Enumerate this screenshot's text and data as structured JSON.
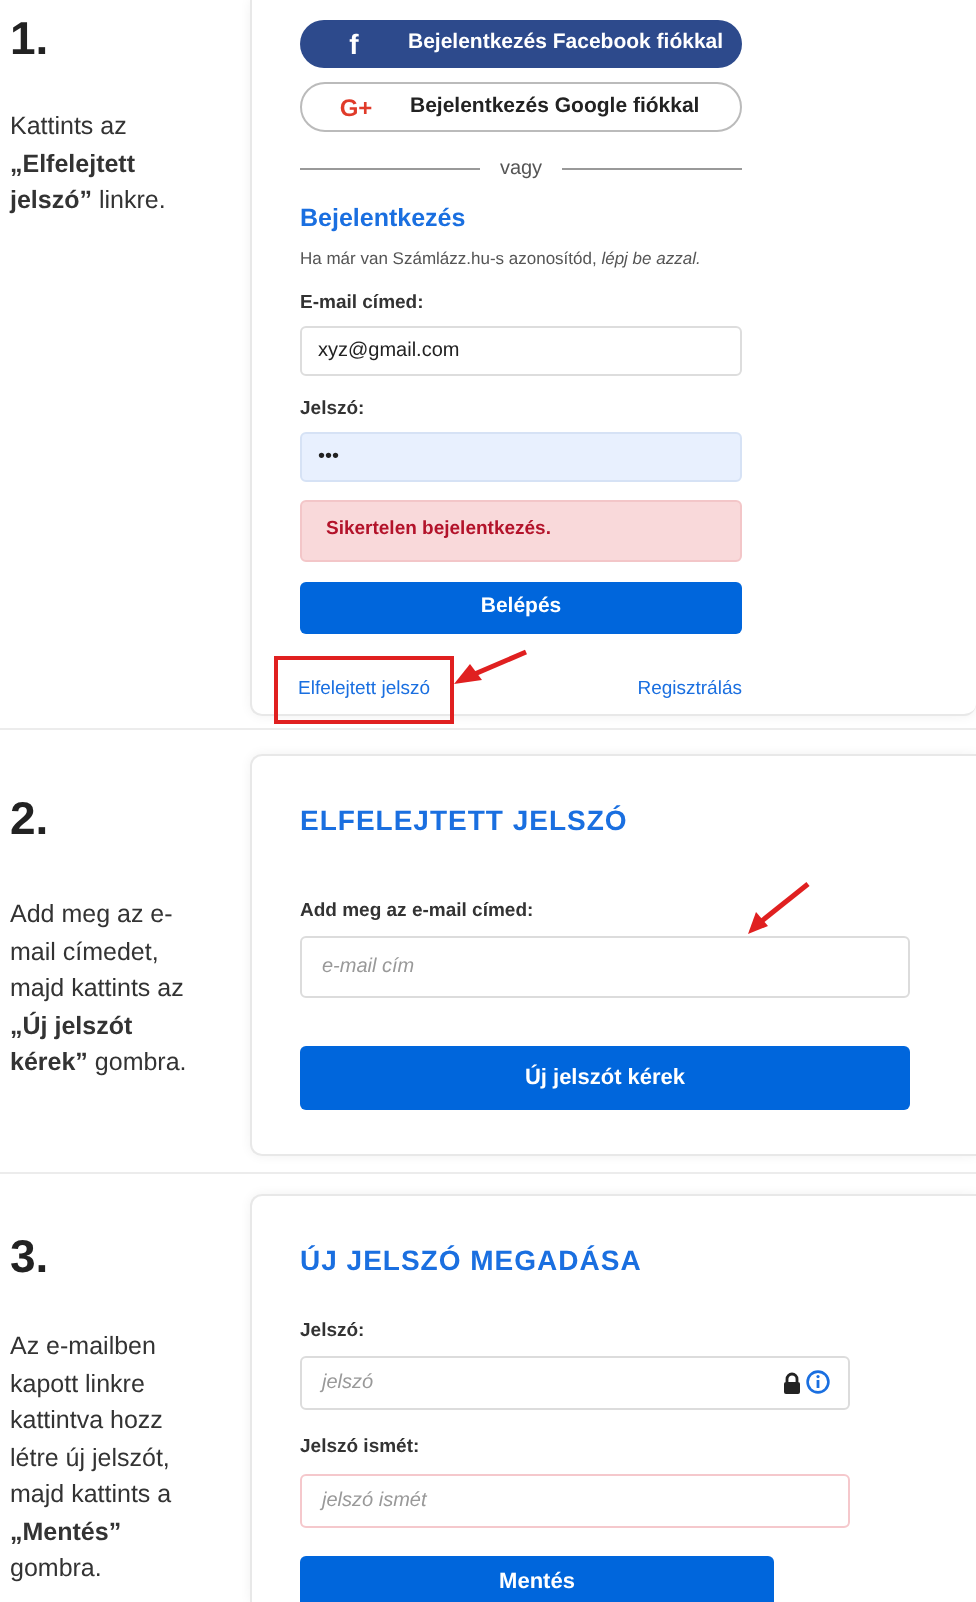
{
  "steps": [
    {
      "number": "1.",
      "instruction": "Kattints az **„Elfelejtett jelszó”** linkre.",
      "panel": {
        "kind": "login",
        "social_buttons": [
          {
            "kind": "facebook",
            "icon": "f",
            "label": "Bejelentkezés Facebook fiókkal"
          },
          {
            "kind": "google",
            "icon": "G+",
            "label": "Bejelentkezés Google fiókkal"
          }
        ],
        "separator": "vagy",
        "heading": "Bejelentkezés",
        "subtitle": "Ha már van Számlázz.hu-s azonosítód, *lépj be azzal.*",
        "fields": [
          {
            "label": "E-mail címed:",
            "value": "xyz@gmail.com",
            "autofilled": false
          },
          {
            "label": "Jelszó:",
            "value": "•••",
            "autofilled": true
          }
        ],
        "error": "Sikertelen bejelentkezés.",
        "submit": "Belépés",
        "links": [
          {
            "label": "Elfelejtett jelszó",
            "highlighted": true
          },
          {
            "label": "Regisztrálás",
            "highlighted": false
          }
        ]
      }
    },
    {
      "number": "2.",
      "instruction": "Add meg az e-mail címedet, majd kattints az **„Új jelszót kérek”** gombra.",
      "panel": {
        "kind": "form",
        "title": "ELFELEJTETT JELSZÓ",
        "fields": [
          {
            "label": "Add meg az e-mail címed:",
            "placeholder": "e-mail cím",
            "pointed": true,
            "invalid": false,
            "icons": false
          }
        ],
        "submit": "Új jelszót kérek",
        "wide_button": true
      }
    },
    {
      "number": "3.",
      "instruction": "Az e-mailben kapott linkre kattintva hozz létre új jelszót, majd kattints a **„Mentés”** gombra.",
      "panel": {
        "kind": "form",
        "title": "ÚJ JELSZÓ MEGADÁSA",
        "fields": [
          {
            "label": "Jelszó:",
            "placeholder": "jelszó",
            "pointed": false,
            "invalid": false,
            "icons": true
          },
          {
            "label": "Jelszó ismét:",
            "placeholder": "jelszó ismét",
            "pointed": false,
            "invalid": true,
            "icons": false
          }
        ],
        "submit": "Mentés",
        "wide_button": false
      }
    }
  ]
}
